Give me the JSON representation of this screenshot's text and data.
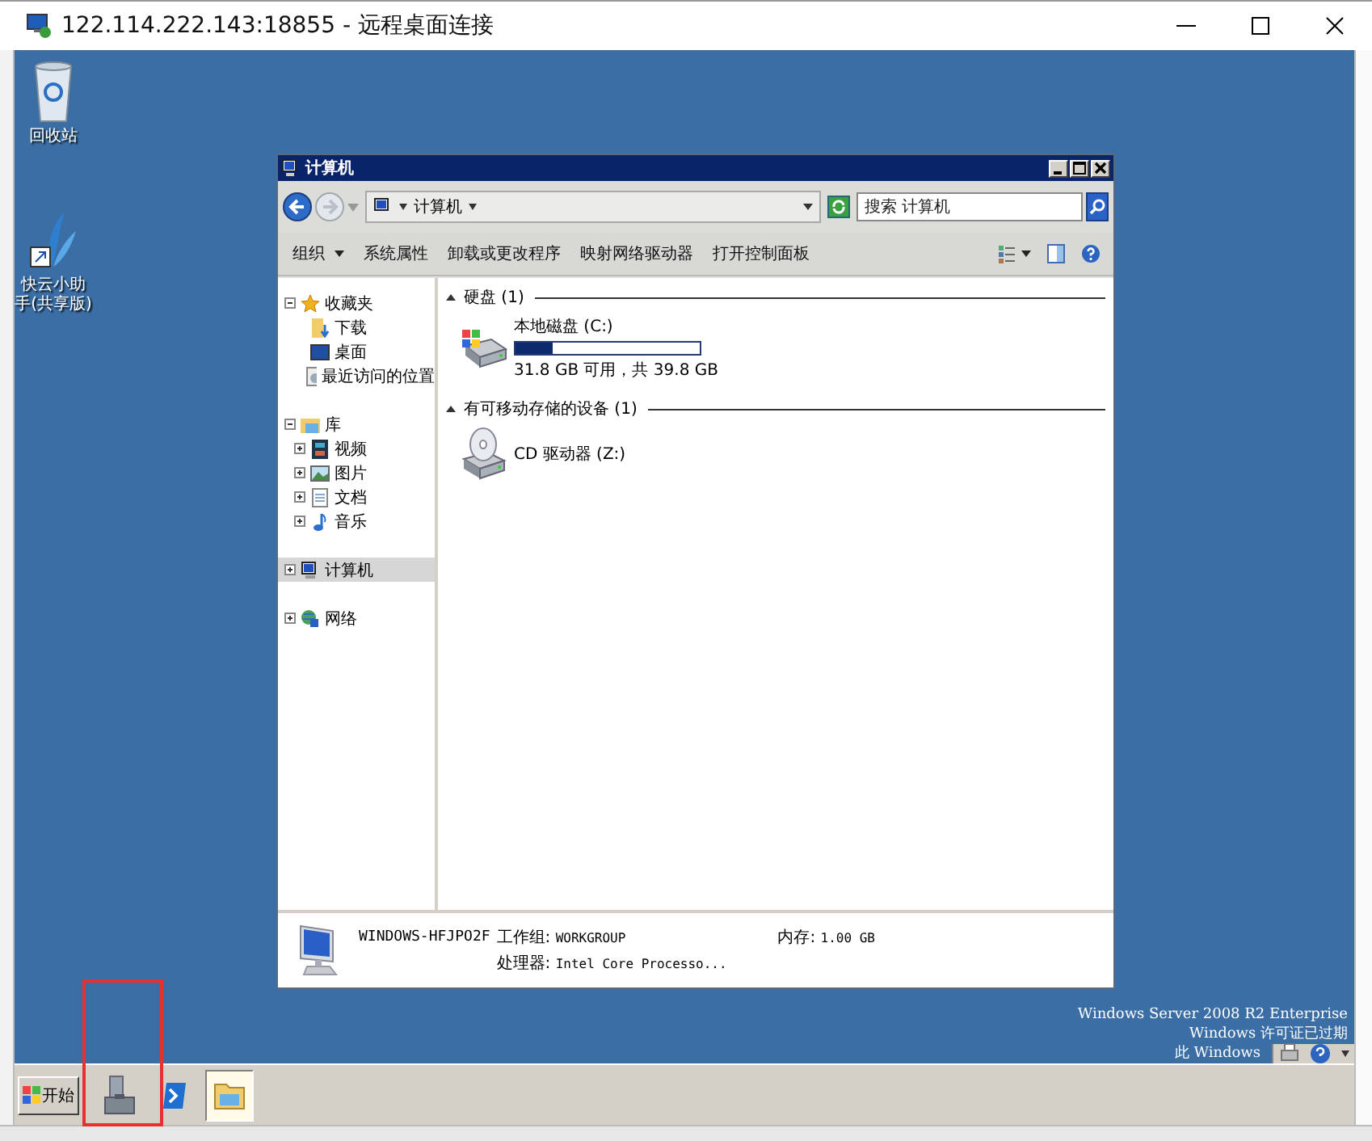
{
  "window": {
    "title": "122.114.222.143:18855 - 远程桌面连接"
  },
  "desktop_icons": [
    {
      "label": "回收站",
      "kind": "recycle"
    },
    {
      "label": "快云小助手(共享版)",
      "kind": "shortcut"
    }
  ],
  "explorer": {
    "title": "计算机",
    "breadcrumb": "计算机",
    "search": {
      "placeholder": "搜索 计算机"
    },
    "toolbar": [
      {
        "label": "组织",
        "kind": "menu"
      },
      {
        "label": "系统属性",
        "kind": "command"
      },
      {
        "label": "卸载或更改程序",
        "kind": "command"
      },
      {
        "label": "映射网络驱动器",
        "kind": "command"
      },
      {
        "label": "打开控制面板",
        "kind": "command"
      }
    ],
    "nav": [
      {
        "label": "收藏夹",
        "kind": "favorites",
        "expanded": true,
        "selected": false,
        "children": [
          {
            "label": "下载",
            "kind": "download"
          },
          {
            "label": "桌面",
            "kind": "desktop"
          },
          {
            "label": "最近访问的位置",
            "kind": "recent"
          }
        ]
      },
      {
        "label": "库",
        "kind": "library",
        "expanded": true,
        "selected": false,
        "children": [
          {
            "label": "视频",
            "kind": "video",
            "expanded": false
          },
          {
            "label": "图片",
            "kind": "picture",
            "expanded": false
          },
          {
            "label": "文档",
            "kind": "document",
            "expanded": false
          },
          {
            "label": "音乐",
            "kind": "music",
            "expanded": false
          }
        ]
      },
      {
        "label": "计算机",
        "kind": "computer",
        "expanded": false,
        "selected": true
      },
      {
        "label": "网络",
        "kind": "network",
        "expanded": false,
        "selected": false
      }
    ],
    "groups": [
      {
        "title": "硬盘 (1)",
        "expanded": true,
        "items": [
          {
            "name": "本地磁盘 (C:)",
            "kind": "disk",
            "level": 0.2,
            "detail": "31.8 GB 可用，共 39.8 GB"
          }
        ]
      },
      {
        "title": "有可移动存储的设备 (1)",
        "expanded": true,
        "items": [
          {
            "name": "CD 驱动器 (Z:)",
            "kind": "cd"
          }
        ]
      }
    ],
    "details": {
      "computer_name": "WINDOWS-HFJPO2F",
      "fields": [
        {
          "label": "工作组:",
          "value": "WORKGROUP"
        },
        {
          "label": "内存:",
          "value": "1.00 GB"
        },
        {
          "label": "处理器:",
          "value": "Intel Core Processo..."
        }
      ]
    }
  },
  "desktop_notice": [
    "Windows Server 2008 R2 Enterprise",
    "Windows 许可证已过期",
    "此 Windows"
  ],
  "taskbar": {
    "start_label": "开始",
    "apps": [
      {
        "kind": "server-manager",
        "selected": false
      },
      {
        "kind": "powershell",
        "selected": false
      },
      {
        "kind": "explorer",
        "selected": true
      }
    ]
  }
}
